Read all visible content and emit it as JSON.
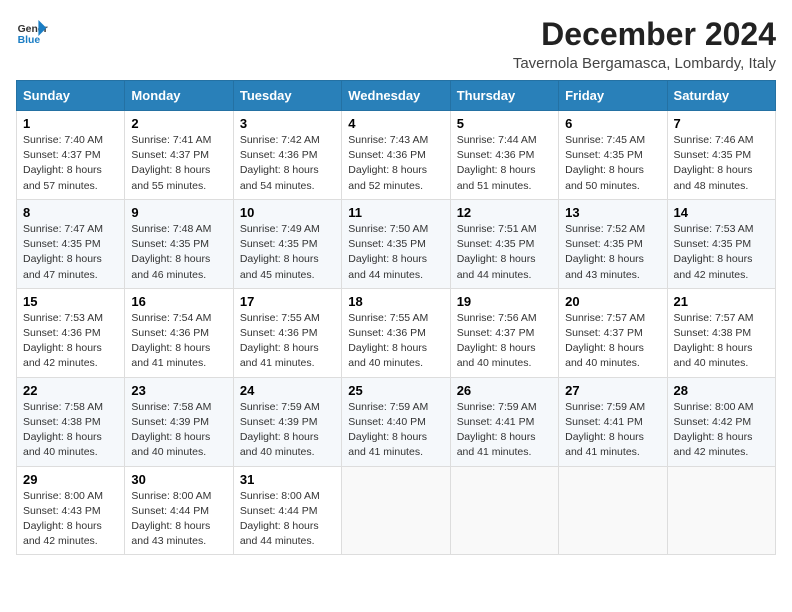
{
  "header": {
    "logo_line1": "General",
    "logo_line2": "Blue",
    "month_year": "December 2024",
    "location": "Tavernola Bergamasca, Lombardy, Italy"
  },
  "weekdays": [
    "Sunday",
    "Monday",
    "Tuesday",
    "Wednesday",
    "Thursday",
    "Friday",
    "Saturday"
  ],
  "weeks": [
    [
      {
        "day": "1",
        "sunrise": "Sunrise: 7:40 AM",
        "sunset": "Sunset: 4:37 PM",
        "daylight": "Daylight: 8 hours and 57 minutes."
      },
      {
        "day": "2",
        "sunrise": "Sunrise: 7:41 AM",
        "sunset": "Sunset: 4:37 PM",
        "daylight": "Daylight: 8 hours and 55 minutes."
      },
      {
        "day": "3",
        "sunrise": "Sunrise: 7:42 AM",
        "sunset": "Sunset: 4:36 PM",
        "daylight": "Daylight: 8 hours and 54 minutes."
      },
      {
        "day": "4",
        "sunrise": "Sunrise: 7:43 AM",
        "sunset": "Sunset: 4:36 PM",
        "daylight": "Daylight: 8 hours and 52 minutes."
      },
      {
        "day": "5",
        "sunrise": "Sunrise: 7:44 AM",
        "sunset": "Sunset: 4:36 PM",
        "daylight": "Daylight: 8 hours and 51 minutes."
      },
      {
        "day": "6",
        "sunrise": "Sunrise: 7:45 AM",
        "sunset": "Sunset: 4:35 PM",
        "daylight": "Daylight: 8 hours and 50 minutes."
      },
      {
        "day": "7",
        "sunrise": "Sunrise: 7:46 AM",
        "sunset": "Sunset: 4:35 PM",
        "daylight": "Daylight: 8 hours and 48 minutes."
      }
    ],
    [
      {
        "day": "8",
        "sunrise": "Sunrise: 7:47 AM",
        "sunset": "Sunset: 4:35 PM",
        "daylight": "Daylight: 8 hours and 47 minutes."
      },
      {
        "day": "9",
        "sunrise": "Sunrise: 7:48 AM",
        "sunset": "Sunset: 4:35 PM",
        "daylight": "Daylight: 8 hours and 46 minutes."
      },
      {
        "day": "10",
        "sunrise": "Sunrise: 7:49 AM",
        "sunset": "Sunset: 4:35 PM",
        "daylight": "Daylight: 8 hours and 45 minutes."
      },
      {
        "day": "11",
        "sunrise": "Sunrise: 7:50 AM",
        "sunset": "Sunset: 4:35 PM",
        "daylight": "Daylight: 8 hours and 44 minutes."
      },
      {
        "day": "12",
        "sunrise": "Sunrise: 7:51 AM",
        "sunset": "Sunset: 4:35 PM",
        "daylight": "Daylight: 8 hours and 44 minutes."
      },
      {
        "day": "13",
        "sunrise": "Sunrise: 7:52 AM",
        "sunset": "Sunset: 4:35 PM",
        "daylight": "Daylight: 8 hours and 43 minutes."
      },
      {
        "day": "14",
        "sunrise": "Sunrise: 7:53 AM",
        "sunset": "Sunset: 4:35 PM",
        "daylight": "Daylight: 8 hours and 42 minutes."
      }
    ],
    [
      {
        "day": "15",
        "sunrise": "Sunrise: 7:53 AM",
        "sunset": "Sunset: 4:36 PM",
        "daylight": "Daylight: 8 hours and 42 minutes."
      },
      {
        "day": "16",
        "sunrise": "Sunrise: 7:54 AM",
        "sunset": "Sunset: 4:36 PM",
        "daylight": "Daylight: 8 hours and 41 minutes."
      },
      {
        "day": "17",
        "sunrise": "Sunrise: 7:55 AM",
        "sunset": "Sunset: 4:36 PM",
        "daylight": "Daylight: 8 hours and 41 minutes."
      },
      {
        "day": "18",
        "sunrise": "Sunrise: 7:55 AM",
        "sunset": "Sunset: 4:36 PM",
        "daylight": "Daylight: 8 hours and 40 minutes."
      },
      {
        "day": "19",
        "sunrise": "Sunrise: 7:56 AM",
        "sunset": "Sunset: 4:37 PM",
        "daylight": "Daylight: 8 hours and 40 minutes."
      },
      {
        "day": "20",
        "sunrise": "Sunrise: 7:57 AM",
        "sunset": "Sunset: 4:37 PM",
        "daylight": "Daylight: 8 hours and 40 minutes."
      },
      {
        "day": "21",
        "sunrise": "Sunrise: 7:57 AM",
        "sunset": "Sunset: 4:38 PM",
        "daylight": "Daylight: 8 hours and 40 minutes."
      }
    ],
    [
      {
        "day": "22",
        "sunrise": "Sunrise: 7:58 AM",
        "sunset": "Sunset: 4:38 PM",
        "daylight": "Daylight: 8 hours and 40 minutes."
      },
      {
        "day": "23",
        "sunrise": "Sunrise: 7:58 AM",
        "sunset": "Sunset: 4:39 PM",
        "daylight": "Daylight: 8 hours and 40 minutes."
      },
      {
        "day": "24",
        "sunrise": "Sunrise: 7:59 AM",
        "sunset": "Sunset: 4:39 PM",
        "daylight": "Daylight: 8 hours and 40 minutes."
      },
      {
        "day": "25",
        "sunrise": "Sunrise: 7:59 AM",
        "sunset": "Sunset: 4:40 PM",
        "daylight": "Daylight: 8 hours and 41 minutes."
      },
      {
        "day": "26",
        "sunrise": "Sunrise: 7:59 AM",
        "sunset": "Sunset: 4:41 PM",
        "daylight": "Daylight: 8 hours and 41 minutes."
      },
      {
        "day": "27",
        "sunrise": "Sunrise: 7:59 AM",
        "sunset": "Sunset: 4:41 PM",
        "daylight": "Daylight: 8 hours and 41 minutes."
      },
      {
        "day": "28",
        "sunrise": "Sunrise: 8:00 AM",
        "sunset": "Sunset: 4:42 PM",
        "daylight": "Daylight: 8 hours and 42 minutes."
      }
    ],
    [
      {
        "day": "29",
        "sunrise": "Sunrise: 8:00 AM",
        "sunset": "Sunset: 4:43 PM",
        "daylight": "Daylight: 8 hours and 42 minutes."
      },
      {
        "day": "30",
        "sunrise": "Sunrise: 8:00 AM",
        "sunset": "Sunset: 4:44 PM",
        "daylight": "Daylight: 8 hours and 43 minutes."
      },
      {
        "day": "31",
        "sunrise": "Sunrise: 8:00 AM",
        "sunset": "Sunset: 4:44 PM",
        "daylight": "Daylight: 8 hours and 44 minutes."
      },
      null,
      null,
      null,
      null
    ]
  ]
}
